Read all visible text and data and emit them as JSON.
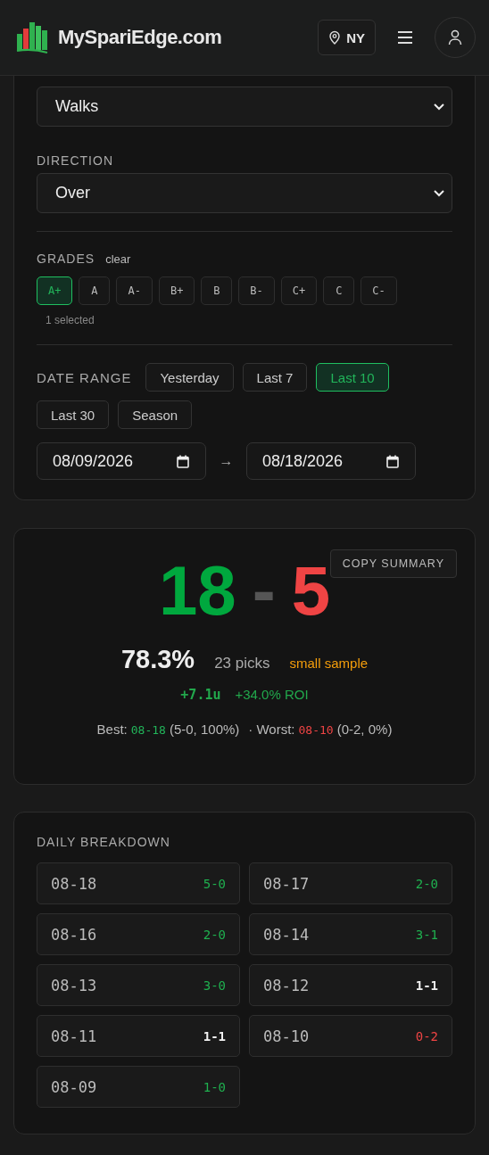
{
  "header": {
    "brand": "MySpariEdge.com",
    "location": "NY"
  },
  "filters": {
    "market": {
      "value": "Walks"
    },
    "direction": {
      "label": "DIRECTION",
      "value": "Over"
    },
    "grades": {
      "label": "GRADES",
      "clear": "clear",
      "count": "1 selected",
      "items": [
        {
          "label": "A+",
          "selected": true
        },
        {
          "label": "A",
          "selected": false
        },
        {
          "label": "A-",
          "selected": false
        },
        {
          "label": "B+",
          "selected": false
        },
        {
          "label": "B",
          "selected": false
        },
        {
          "label": "B-",
          "selected": false
        },
        {
          "label": "C+",
          "selected": false
        },
        {
          "label": "C",
          "selected": false
        },
        {
          "label": "C-",
          "selected": false
        }
      ]
    },
    "date_range": {
      "label": "DATE RANGE",
      "presets": [
        {
          "label": "Yesterday",
          "selected": false
        },
        {
          "label": "Last 7",
          "selected": false
        },
        {
          "label": "Last 10",
          "selected": true
        },
        {
          "label": "Last 30",
          "selected": false
        },
        {
          "label": "Season",
          "selected": false
        }
      ],
      "from": "08/09/2026",
      "arrow": "→",
      "to": "08/18/2026"
    }
  },
  "summary": {
    "copy_button": "COPY SUMMARY",
    "wins": "18",
    "dash": "-",
    "losses": "5",
    "pct": "78.3%",
    "picks": "23 picks",
    "warning": "small sample",
    "units": "+7.1u",
    "roi": "+34.0% ROI",
    "best": {
      "label": "Best:",
      "date": "08-18",
      "detail": "(5-0, 100%)"
    },
    "worst": {
      "label": "· Worst:",
      "date": "08-10",
      "detail": "(0-2, 0%)"
    }
  },
  "daily": {
    "title": "DAILY BREAKDOWN",
    "days": [
      {
        "date": "08-18",
        "record": "5-0",
        "kind": "win"
      },
      {
        "date": "08-17",
        "record": "2-0",
        "kind": "win"
      },
      {
        "date": "08-16",
        "record": "2-0",
        "kind": "win"
      },
      {
        "date": "08-14",
        "record": "3-1",
        "kind": "win"
      },
      {
        "date": "08-13",
        "record": "3-0",
        "kind": "win"
      },
      {
        "date": "08-12",
        "record": "1-1",
        "kind": "push"
      },
      {
        "date": "08-11",
        "record": "1-1",
        "kind": "push"
      },
      {
        "date": "08-10",
        "record": "0-2",
        "kind": "loss"
      },
      {
        "date": "08-09",
        "record": "1-0",
        "kind": "win"
      }
    ]
  }
}
